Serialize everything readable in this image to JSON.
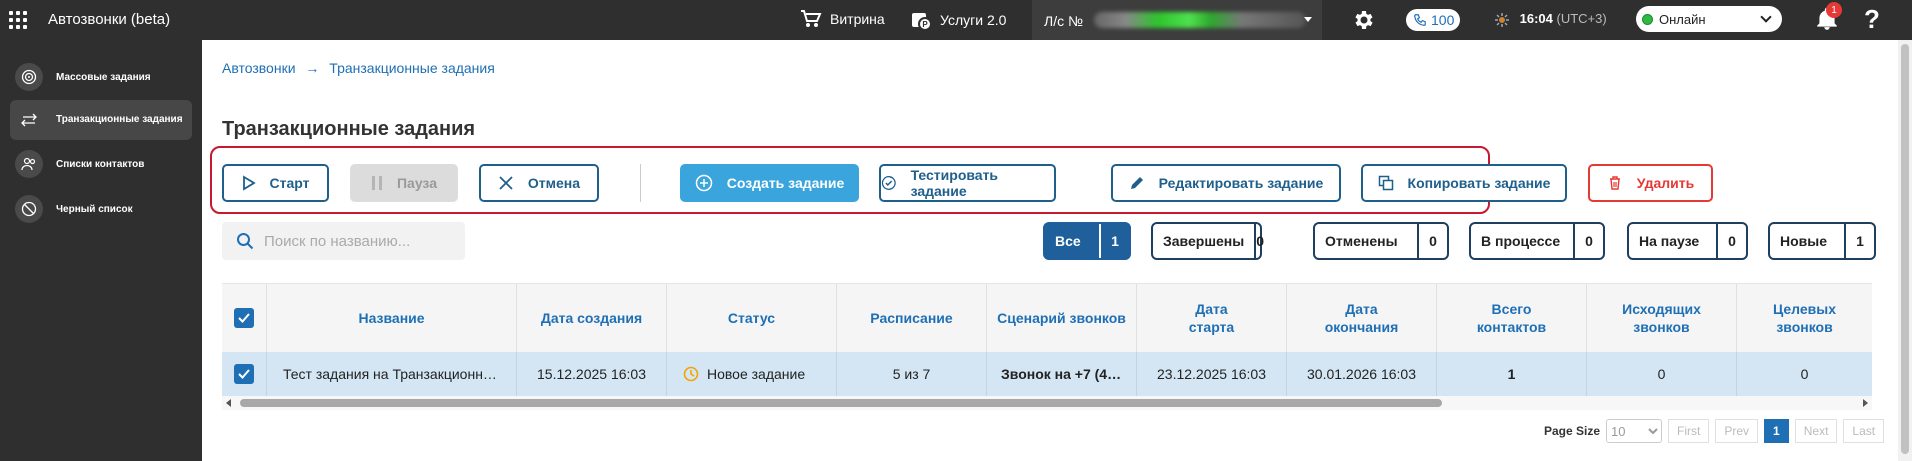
{
  "header": {
    "title": "Автозвонки (beta)",
    "showcase": "Витрина",
    "services": "Услуги 2.0",
    "account_prefix": "Л/с №",
    "calls_count": "100",
    "time": "16:04",
    "timezone": "(UTC+3)",
    "status": "Онлайн",
    "notifications_count": "1",
    "help": "?"
  },
  "sidebar": {
    "items": [
      {
        "label": "Массовые задания"
      },
      {
        "label": "Транзакционные задания"
      },
      {
        "label": "Списки контактов"
      },
      {
        "label": "Черный список"
      }
    ]
  },
  "breadcrumb": {
    "root": "Автозвонки",
    "arrow": "→",
    "current": "Транзакционные задания"
  },
  "page_title": "Транзакционные задания",
  "toolbar": {
    "start": "Старт",
    "pause": "Пауза",
    "cancel": "Отмена",
    "create": "Создать задание",
    "test": "Тестировать задание",
    "edit": "Редактировать задание",
    "copy": "Копировать задание",
    "delete": "Удалить"
  },
  "search": {
    "placeholder": "Поиск по названию..."
  },
  "filters": [
    {
      "label": "Все",
      "count": "1"
    },
    {
      "label": "Завершены",
      "count": "0"
    },
    {
      "label": "Отменены",
      "count": "0"
    },
    {
      "label": "В процессе",
      "count": "0"
    },
    {
      "label": "На паузе",
      "count": "0"
    },
    {
      "label": "Новые",
      "count": "1"
    }
  ],
  "table": {
    "columns": [
      "Название",
      "Дата создания",
      "Статус",
      "Расписание",
      "Сценарий звонков",
      "Дата\nстарта",
      "Дата\nокончания",
      "Всего\nконтактов",
      "Исходящих\nзвонков",
      "Целевых\nзвонков"
    ],
    "rows": [
      {
        "name": "Тест задания на Транзакционн…",
        "created": "15.12.2025 16:03",
        "status": "Новое задание",
        "schedule": "5 из 7",
        "scenario": "Звонок на +7 (4…",
        "start": "23.12.2025 16:03",
        "end": "30.01.2026 16:03",
        "contacts": "1",
        "outgoing": "0",
        "target": "0"
      }
    ]
  },
  "pager": {
    "page_size_label": "Page Size",
    "page_size": "10",
    "first": "First",
    "prev": "Prev",
    "current": "1",
    "next": "Next",
    "last": "Last"
  },
  "colors": {
    "primary": "#1f6fb5",
    "accent": "#3aa5dc",
    "danger": "#e53935",
    "highlight": "#c6192f"
  }
}
